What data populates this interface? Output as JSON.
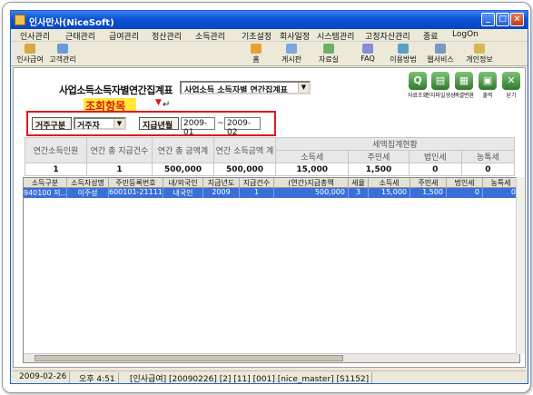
{
  "window": {
    "title": "인사만사(NiceSoft)"
  },
  "menu": [
    "인사관리",
    "근태관리",
    "급여관리",
    "정산관리",
    "소득관리",
    "기초설정",
    "회사일정",
    "시스템관리",
    "고정자산관리",
    "종료",
    "LogOn"
  ],
  "toolbar": {
    "left": [
      "인사급여",
      "고객관리"
    ],
    "right": [
      "홈",
      "게시판",
      "자료실",
      "FAQ",
      "이용방법",
      "웹서비스",
      "개인정보"
    ]
  },
  "report": {
    "title": "사업소득소득자별연간집계표",
    "select_value": "사업소득 소득자별 연간집계표",
    "buttons": [
      "자료조회",
      "전자파일생성",
      "엑셀변환",
      "출력",
      "닫기"
    ]
  },
  "annotation": {
    "text": "조회항목"
  },
  "filters": {
    "resident_label": "거주구분",
    "resident_value": "거주자",
    "period_label": "지급년월",
    "from": "2009-01",
    "to": "2009-02",
    "tilde": "~"
  },
  "summary": {
    "headers": [
      "연간소득인원",
      "연간 총 지급건수",
      "연간 총 금액계",
      "연간 소득금액 계"
    ],
    "tax_header": "세액집계현황",
    "tax_headers": [
      "소득세",
      "주민세",
      "법인세",
      "농특세"
    ],
    "values": [
      "1",
      "1",
      "500,000",
      "500,000",
      "15,000",
      "1,500",
      "0",
      "0"
    ]
  },
  "grid": {
    "columns": [
      "소득구분",
      "소득자성명",
      "주민등록번호",
      "내/외국인",
      "지급년도",
      "지급건수",
      "(연간)지급총액",
      "세율",
      "소득세",
      "주민세",
      "법인세",
      "농특세"
    ],
    "row": [
      "940100 저...",
      "이주성",
      "600101-2111115",
      "내국인",
      "2009",
      "1",
      "500,000",
      "3",
      "15,000",
      "1,500",
      "0",
      "0"
    ]
  },
  "status": [
    "2009-02-26",
    "오후 4:51",
    "[인사급여] [20090226] [2] [11] [001] [nice_master] [S1152]"
  ]
}
